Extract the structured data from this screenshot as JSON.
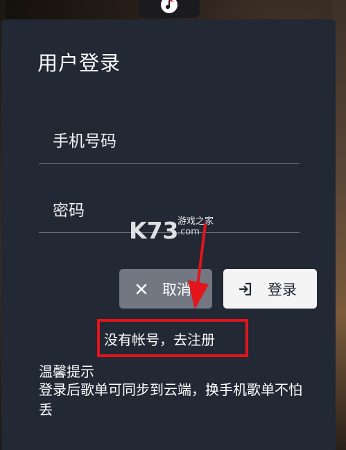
{
  "dialog": {
    "title": "用户登录",
    "phone_placeholder": "手机号码",
    "password_placeholder": "密码",
    "cancel_label": "取消",
    "login_label": "登录",
    "register_link": "没有帐号，去注册",
    "tip_title": "温馨提示",
    "tip_body": "登录后歌单可同步到云端，换手机歌单不怕丢"
  },
  "watermark": {
    "brand": "K73",
    "site_name": "游戏之家",
    "domain": ".com"
  },
  "colors": {
    "dialog_bg": "#222834",
    "cancel_bg": "#727781",
    "login_bg": "#f4f4f4",
    "highlight": "#e3141b"
  },
  "icons": {
    "app": "music-note-icon",
    "cancel": "close-icon",
    "login": "sign-in-icon"
  }
}
